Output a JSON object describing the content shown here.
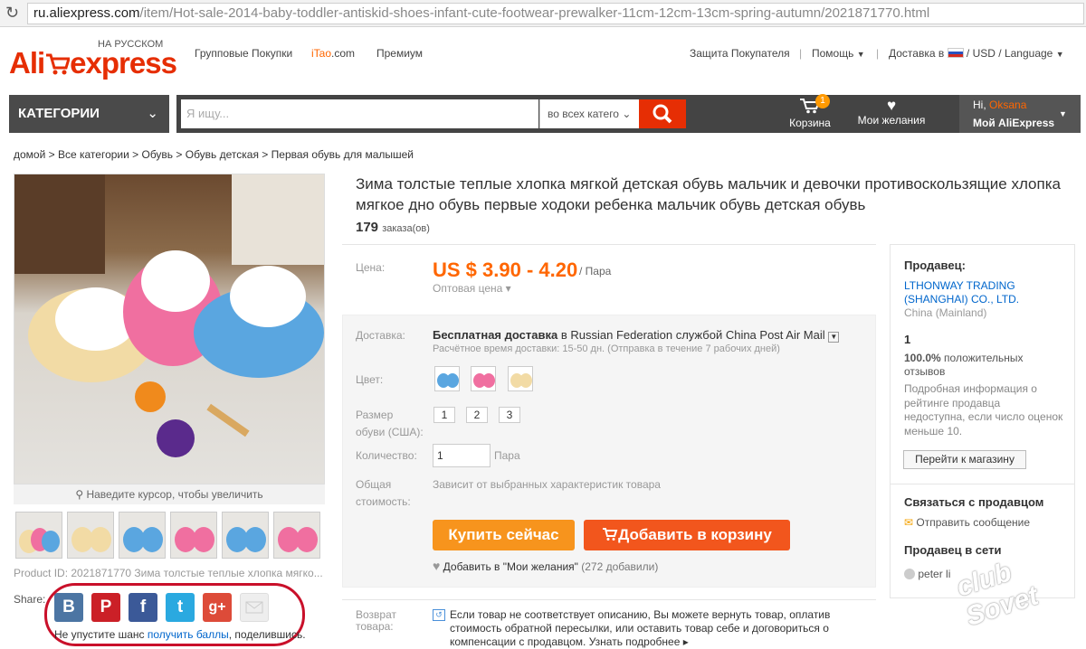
{
  "browser": {
    "url_host": "ru.aliexpress.com",
    "url_path": "/item/Hot-sale-2014-baby-toddler-antiskid-shoes-infant-cute-footwear-prewalker-11cm-12cm-13cm-spring-autumn/2021871770.html"
  },
  "header": {
    "logo_ali": "Ali",
    "logo_express": "express",
    "lang_label": "НА РУССКОМ",
    "nav": [
      "Групповые Покупки",
      "iTao.com",
      "Премиум"
    ],
    "nav_itao_brand": "iTao",
    "nav_itao_suffix": ".com",
    "protection": "Защита Покупателя",
    "help": "Помощь",
    "delivery": "Доставка в",
    "currency": "USD / Language"
  },
  "searchbar": {
    "categories": "КАТЕГОРИИ",
    "placeholder": "Я ищу...",
    "scope": "во всех катего",
    "cart_label": "Корзина",
    "cart_count": "1",
    "wishlist_label": "Мои желания",
    "hi": "Hi,",
    "user_name": "Oksana",
    "my_account": "Мой AliExpress"
  },
  "breadcrumb": "домой > Все категории > Обувь > Обувь детская > Первая обувь для малышей",
  "gallery": {
    "zoom_hint": "Наведите курсор, чтобы увеличить"
  },
  "product": {
    "title": "Зима толстые теплые хлопка мягкой детская обувь мальчик и девочки противоскользящие хлопка мягкое дно обувь первые ходоки ребенка мальчик обувь детская обувь",
    "orders_count": "179",
    "orders_label": "заказа(ов)",
    "product_id": "Product ID: 2021871770 Зима толстые теплые хлопка мягко...",
    "price_label": "Цена:",
    "price": "US $ 3.90 - 4.20",
    "price_unit": "/ Пара",
    "wholesale": "Оптовая цена",
    "shipping_label": "Доставка:",
    "shipping_free": "Бесплатная доставка",
    "shipping_in": "в",
    "shipping_dest": "Russian Federation службой China Post Air Mail",
    "shipping_time": "Расчётное время доставки: 15-50 дн. (Отправка в течение 7 рабочих дней)",
    "color_label": "Цвет:",
    "size_label_1": "Размер",
    "size_label_2": "обуви (США):",
    "sizes": [
      "1",
      "2",
      "3"
    ],
    "qty_label": "Количество:",
    "qty_value": "1",
    "qty_unit": "Пара",
    "total_label_1": "Общая",
    "total_label_2": "стоимость:",
    "total_value": "Зависит от выбранных характеристик товара",
    "buy_now": "Купить сейчас",
    "add_to_cart": "Добавить в корзину",
    "wish_add": "Добавить в \"Мои желания\"",
    "wish_count": "(272 добавили)",
    "return_label_1": "Возврат",
    "return_label_2": "товара:",
    "return_text_1": "Если товар не соответствует описанию, Вы можете вернуть товар, оплатив",
    "return_text_2": "стоимость обратной пересылки, или оставить товар себе и договориться о",
    "return_text_3": "компенсации с продавцом.",
    "return_more": "Узнать подробнее"
  },
  "share": {
    "label": "Share:",
    "buttons": [
      "B",
      "P",
      "f",
      "t",
      "g+",
      ""
    ],
    "text_before": "Не упустите шанс",
    "text_link": "получить баллы",
    "text_after": ", поделившись."
  },
  "seller": {
    "label": "Продавец:",
    "name_1": "LTHONWAY TRADING",
    "name_2": "(SHANGHAI) CO., LTD.",
    "country": "China (Mainland)",
    "level": "1",
    "positive_pct": "100.0%",
    "positive_1": "положительных",
    "positive_2": "отзывов",
    "rating_note_1": "Подробная информация о",
    "rating_note_2": "рейтинге продавца",
    "rating_note_3": "недоступна, если число оценок",
    "rating_note_4": "меньше 10.",
    "go_store": "Перейти к магазину",
    "contact": "Связаться с продавцом",
    "send_msg": "Отправить сообщение",
    "online": "Продавец в сети",
    "online_user": "peter li"
  },
  "watermark": "club Sovet",
  "colors": {
    "accent": "#f60",
    "brand_red": "#e62e04",
    "buy": "#f7941d",
    "cart": "#f2561d",
    "highlight": "#c9102a"
  }
}
